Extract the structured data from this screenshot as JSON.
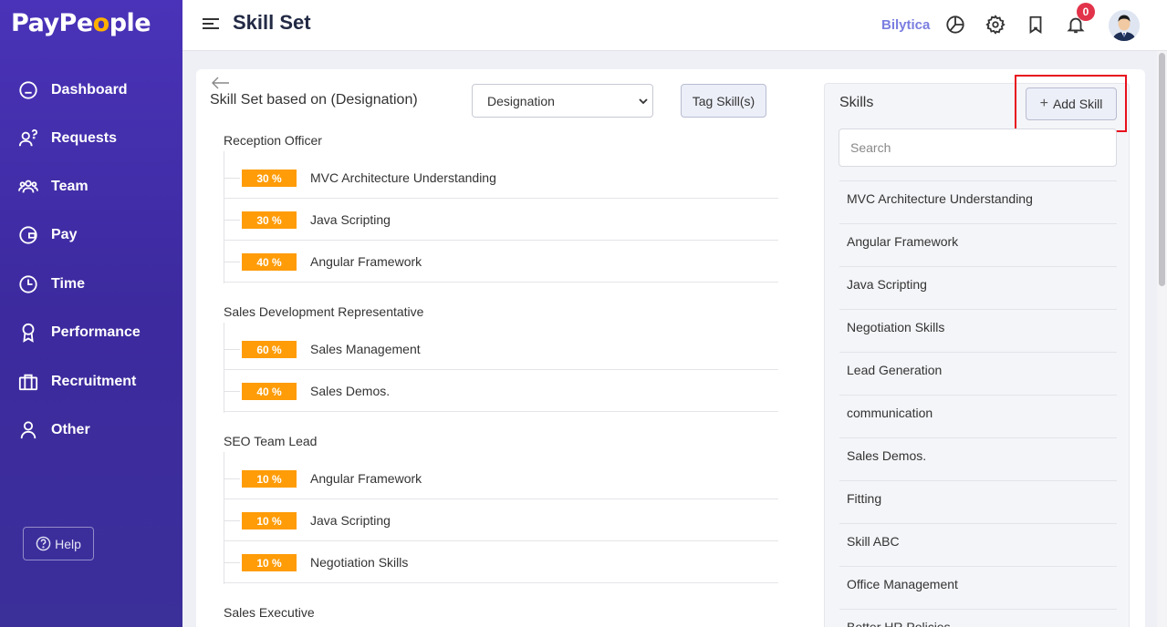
{
  "brand": {
    "part1": "PayPe",
    "part2": "o",
    "part3": "ple"
  },
  "sidebar": {
    "items": [
      {
        "label": "Dashboard",
        "icon": "home-icon"
      },
      {
        "label": "Requests",
        "icon": "user-question-icon"
      },
      {
        "label": "Team",
        "icon": "team-icon"
      },
      {
        "label": "Pay",
        "icon": "wallet-icon"
      },
      {
        "label": "Time",
        "icon": "clock-icon"
      },
      {
        "label": "Performance",
        "icon": "award-icon"
      },
      {
        "label": "Recruitment",
        "icon": "briefcase-icon"
      },
      {
        "label": "Other",
        "icon": "person-icon"
      }
    ],
    "help_label": "Help"
  },
  "header": {
    "title": "Skill Set",
    "company": "Bilytica",
    "notification_count": "0"
  },
  "main": {
    "section_title": "Skill Set based on (Designation)",
    "select_value": "Designation",
    "tag_button": "Tag Skill(s)",
    "groups": [
      {
        "title": "Reception Officer",
        "skills": [
          {
            "pct": "30 %",
            "name": "MVC Architecture Understanding"
          },
          {
            "pct": "30 %",
            "name": "Java Scripting"
          },
          {
            "pct": "40 %",
            "name": "Angular Framework"
          }
        ]
      },
      {
        "title": "Sales Development Representative",
        "skills": [
          {
            "pct": "60 %",
            "name": "Sales Management"
          },
          {
            "pct": "40 %",
            "name": "Sales Demos."
          }
        ]
      },
      {
        "title": "SEO Team Lead",
        "skills": [
          {
            "pct": "10 %",
            "name": "Angular Framework"
          },
          {
            "pct": "10 %",
            "name": "Java Scripting"
          },
          {
            "pct": "10 %",
            "name": "Negotiation Skills"
          }
        ]
      },
      {
        "title": "Sales Executive",
        "skills": []
      }
    ]
  },
  "skills_panel": {
    "title": "Skills",
    "add_button": "Add Skill",
    "search_placeholder": "Search",
    "items": [
      "MVC Architecture Understanding",
      "Angular Framework",
      "Java Scripting",
      "Negotiation Skills",
      "Lead Generation",
      "communication",
      "Sales Demos.",
      "Fitting",
      "Skill ABC",
      "Office Management",
      "Better HR Policies"
    ]
  },
  "colors": {
    "sidebar": "#4a33b8",
    "badge_pct": "#ff9c08",
    "notification": "#e2334a",
    "highlight": "#e8101d",
    "company": "#7a7ee0"
  }
}
